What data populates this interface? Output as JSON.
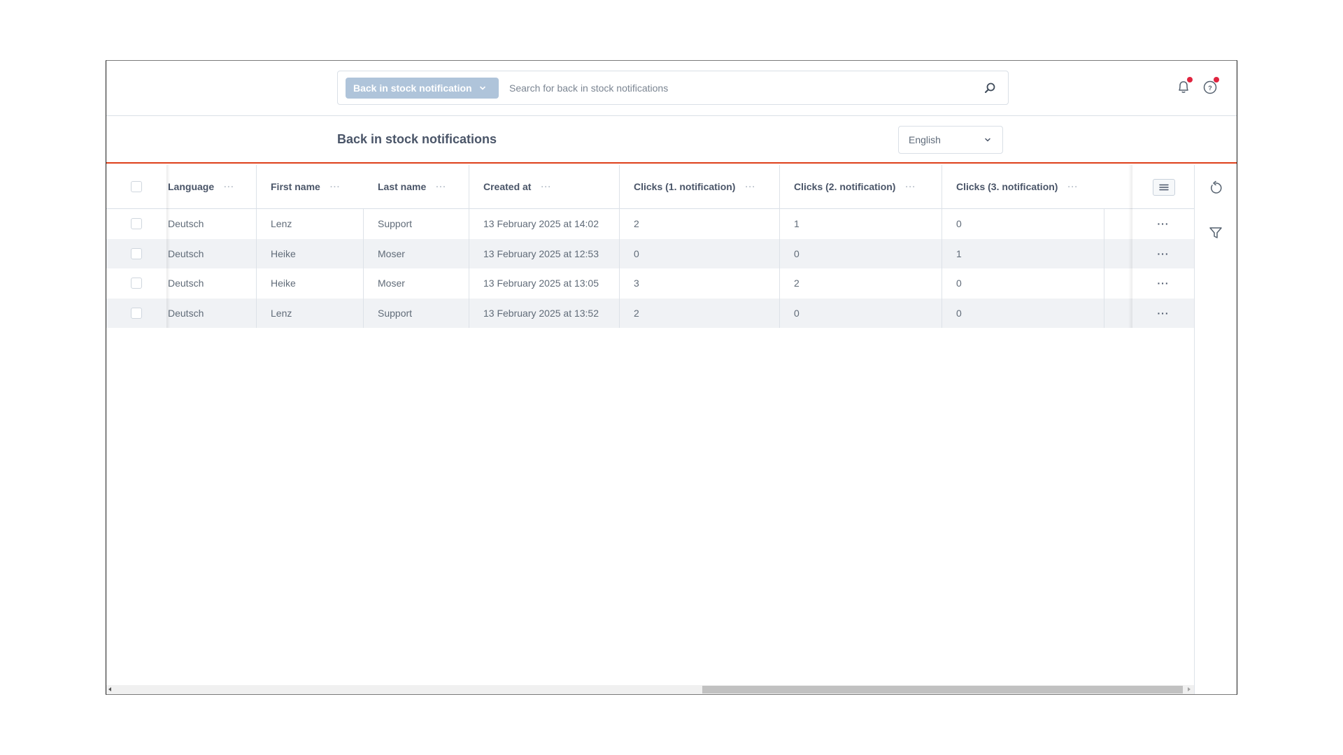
{
  "topbar": {
    "scope_label": "Back in stock notification",
    "search_placeholder": "Search for back in stock notifications",
    "search_value": "",
    "icons": [
      "notification-bell-icon",
      "help-icon"
    ]
  },
  "page": {
    "title": "Back in stock notifications",
    "language_select": "English"
  },
  "table": {
    "columns": [
      {
        "label": "Language"
      },
      {
        "label": "First name"
      },
      {
        "label": "Last name"
      },
      {
        "label": "Created at"
      },
      {
        "label": "Clicks (1. notification)"
      },
      {
        "label": "Clicks (2. notification)"
      },
      {
        "label": "Clicks (3. notification)"
      }
    ],
    "col_menu": "···",
    "row_menu": "···",
    "rows": [
      {
        "language": "Deutsch",
        "first_name": "Lenz",
        "last_name": "Support",
        "created_at": "13 February 2025 at 14:02",
        "clicks1": "2",
        "clicks2": "1",
        "clicks3": "0"
      },
      {
        "language": "Deutsch",
        "first_name": "Heike",
        "last_name": "Moser",
        "created_at": "13 February 2025 at 12:53",
        "clicks1": "0",
        "clicks2": "0",
        "clicks3": "1"
      },
      {
        "language": "Deutsch",
        "first_name": "Heike",
        "last_name": "Moser",
        "created_at": "13 February 2025 at 13:05",
        "clicks1": "3",
        "clicks2": "2",
        "clicks3": "0"
      },
      {
        "language": "Deutsch",
        "first_name": "Lenz",
        "last_name": "Support",
        "created_at": "13 February 2025 at 13:52",
        "clicks1": "2",
        "clicks2": "0",
        "clicks3": "0"
      }
    ]
  },
  "side_actions": [
    "reset-icon",
    "filter-icon"
  ],
  "colors": {
    "accent": "#de3f1a",
    "scope_pill": "#afc4da",
    "notification_dot": "#e0243f"
  }
}
